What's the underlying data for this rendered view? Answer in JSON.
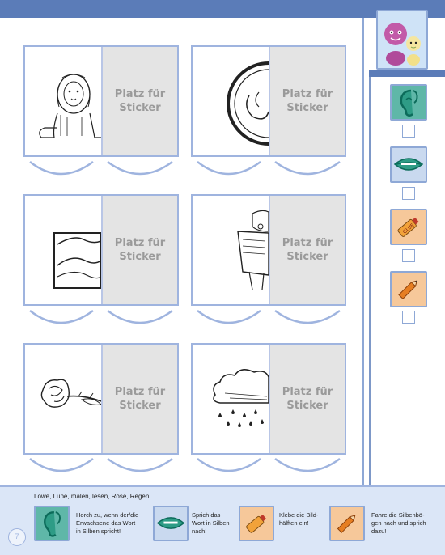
{
  "cards": [
    {
      "picture": "lion-icon",
      "sticker_label": "Platz für\nSticker"
    },
    {
      "picture": "magnifier-icon",
      "sticker_label": "Platz für\nSticker"
    },
    {
      "picture": "painting-icon",
      "sticker_label": "Platz für\nSticker"
    },
    {
      "picture": "reading-child-icon",
      "sticker_label": "Platz für\nSticker"
    },
    {
      "picture": "rose-icon",
      "sticker_label": "Platz für\nSticker"
    },
    {
      "picture": "rain-cloud-icon",
      "sticker_label": "Platz für\nSticker"
    }
  ],
  "sidebar": {
    "mascot": "mascot-figures-icon",
    "items": [
      {
        "icon": "ear-icon"
      },
      {
        "icon": "mouth-icon"
      },
      {
        "icon": "glue-tube-icon"
      },
      {
        "icon": "pencil-icon"
      }
    ]
  },
  "footer": {
    "word_list": "Löwe, Lupe, malen, lesen, Rose, Regen",
    "page_number": "7",
    "instructions": [
      {
        "icon": "ear-icon",
        "text": "Horch zu, wenn der/die\nErwachsene das Wort\nin Silben spricht!"
      },
      {
        "icon": "mouth-icon",
        "text": "Sprich das\nWort in Silben\nnach!"
      },
      {
        "icon": "glue-tube-icon",
        "text": "Klebe die Bild-\nhälften ein!"
      },
      {
        "icon": "pencil-icon",
        "text": "Fahre die Silbenbö-\ngen nach und sprich\ndazu!"
      }
    ]
  },
  "colors": {
    "accent": "#5b7cb8",
    "card_border": "#9fb4df",
    "sticker_fill": "#e4e4e4",
    "icon_bg": "#c9d9ef",
    "glue_bg": "#f6c89a"
  }
}
